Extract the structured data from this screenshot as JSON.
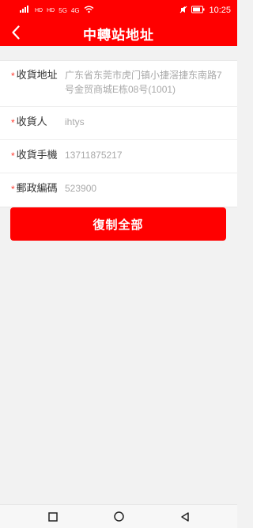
{
  "status_bar": {
    "signal_left_top": "HD",
    "signal_left_bottom": "HD",
    "network_5g": "5G",
    "network_4g": "4G",
    "time": "10:25",
    "icons": [
      "sim-signal-icon",
      "sim-signal-icon",
      "wifi-icon",
      "mute-icon",
      "battery-icon"
    ]
  },
  "header": {
    "title": "中轉站地址",
    "back_icon": "back-arrow-icon"
  },
  "form": {
    "required_mark": "*",
    "rows": [
      {
        "label": "收貨地址",
        "value": "广东省东莞市虎门镇小捷滘捷东南路7号金贸商城E栋08号(1001)"
      },
      {
        "label": "收貨人",
        "value": "ihtys"
      },
      {
        "label": "收貨手機",
        "value": "13711875217"
      },
      {
        "label": "郵政編碼",
        "value": "523900"
      }
    ]
  },
  "actions": {
    "copy_all_label": "復制全部"
  },
  "colors": {
    "primary": "#ff0000",
    "background": "#f2f2f2",
    "card": "#ffffff",
    "label": "#333333",
    "value": "#a9a9a9"
  },
  "nav_bar": {
    "icons": [
      "recent-apps-icon",
      "home-icon",
      "back-icon"
    ]
  }
}
